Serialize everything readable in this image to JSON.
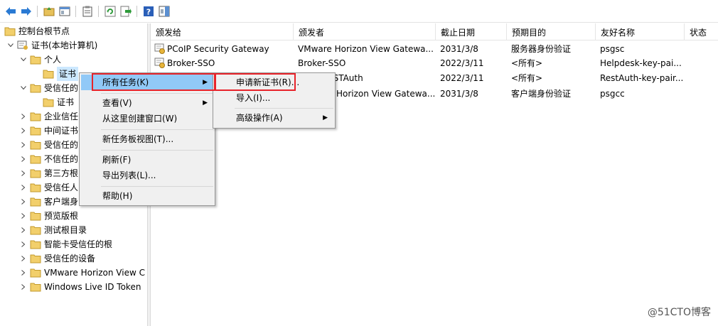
{
  "toolbar": {
    "buttons": [
      "back-icon",
      "forward-icon",
      "up-folder-icon",
      "show-hide-tree-icon",
      "properties-icon",
      "refresh-icon",
      "export-list-icon",
      "help-icon",
      "action-pane-icon"
    ]
  },
  "tree": {
    "items": [
      {
        "label": "控制台根节点"
      },
      {
        "label": "证书(本地计算机)"
      },
      {
        "label": "个人"
      },
      {
        "label": "证书"
      },
      {
        "label": "受信任的"
      },
      {
        "label": "证书"
      },
      {
        "label": "企业信任"
      },
      {
        "label": "中间证书"
      },
      {
        "label": "受信任的"
      },
      {
        "label": "不信任的"
      },
      {
        "label": "第三方根"
      },
      {
        "label": "受信任人"
      },
      {
        "label": "客户端身"
      },
      {
        "label": "预览版根"
      },
      {
        "label": "测试根目录"
      },
      {
        "label": "智能卡受信任的根"
      },
      {
        "label": "受信任的设备"
      },
      {
        "label": "VMware Horizon View C"
      },
      {
        "label": "Windows Live ID Token"
      }
    ]
  },
  "list": {
    "columns": [
      "颁发给",
      "颁发者",
      "截止日期",
      "预期目的",
      "友好名称",
      "状态"
    ],
    "rows": [
      {
        "issued_to": "PCoIP Security Gateway",
        "issuer": "VMware Horizon View Gatewa...",
        "expires": "2031/3/8",
        "purpose": "服务器身份验证",
        "friendly": "psgsc"
      },
      {
        "issued_to": "Broker-SSO",
        "issuer": "Broker-SSO",
        "expires": "2022/3/11",
        "purpose": "<所有>",
        "friendly": "Helpdesk-key-pai..."
      },
      {
        "issued_to": "",
        "issuer": "ESTAuth",
        "expires": "2022/3/11",
        "purpose": "<所有>",
        "friendly": "RestAuth-key-pair..."
      },
      {
        "issued_to": "",
        "issuer": "Horizon View Gatewa...",
        "expires": "2031/3/8",
        "purpose": "客户端身份验证",
        "friendly": "psgcc"
      }
    ]
  },
  "context_menu": {
    "items": [
      "所有任务(K)",
      "查看(V)",
      "从这里创建窗口(W)",
      "新任务板视图(T)...",
      "刷新(F)",
      "导出列表(L)...",
      "帮助(H)"
    ]
  },
  "submenu": {
    "items": [
      "申请新证书(R)...",
      "导入(I)...",
      "高级操作(A)"
    ]
  },
  "watermark": "@51CTO博客",
  "colors": {
    "highlight": "#91c9f7",
    "selection": "#cce8ff",
    "redbox": "#e8232a"
  }
}
